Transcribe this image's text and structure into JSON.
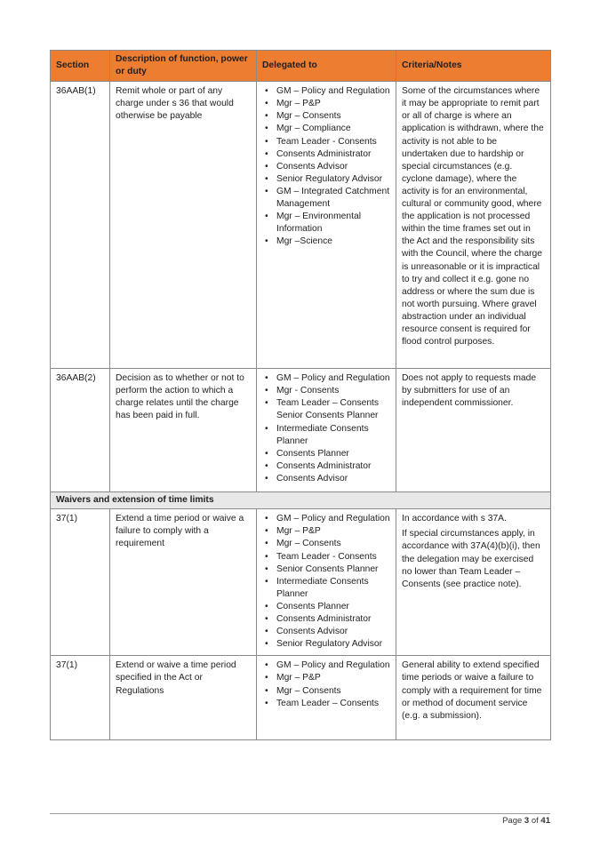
{
  "colors": {
    "header_bg": "#ed7d31",
    "section_row_bg": "#e8e8e8",
    "border": "#8a8a8a"
  },
  "table": {
    "headers": [
      "Section",
      "Description of function, power or duty",
      "Delegated to",
      "Criteria/Notes"
    ],
    "rows": [
      {
        "section": "36AAB(1)",
        "description": "Remit whole or part of any charge under s 36 that would otherwise be payable",
        "delegated": [
          "GM – Policy and Regulation",
          "Mgr – P&P",
          "Mgr – Consents",
          "Mgr – Compliance",
          "Team Leader - Consents",
          "Consents Administrator",
          "Consents Advisor",
          "Senior Regulatory Advisor",
          "GM – Integrated Catchment Management",
          "Mgr – Environmental Information",
          "Mgr –Science"
        ],
        "notes": [
          "Some of the circumstances where it may be appropriate to remit part or all of charge is where an application is withdrawn, where the activity is not able to be undertaken due to hardship or special circumstances (e.g. cyclone damage), where the activity is for an environmental, cultural or community good, where the application is not processed within the time frames set out in the Act and the responsibility sits with the Council, where the charge is unreasonable or it is impractical to try and collect it e.g. gone no address or where the sum due is not worth pursuing. Where gravel abstraction under an individual resource consent is required for flood control purposes."
        ]
      },
      {
        "section": "36AAB(2)",
        "description": "Decision as to whether or not to perform the action to which a charge relates until the charge has been paid in full.",
        "delegated": [
          "GM – Policy and Regulation",
          "Mgr - Consents",
          "Team Leader – Consents Senior Consents Planner",
          "Intermediate Consents Planner",
          "Consents Planner",
          "Consents Administrator",
          "Consents Advisor"
        ],
        "notes": [
          "Does not apply to requests made by submitters for use of an independent commissioner."
        ]
      }
    ],
    "section_heading": "Waivers and extension of time limits",
    "rows2": [
      {
        "section": "37(1)",
        "description": "Extend a time period or waive a failure to comply with a requirement",
        "delegated": [
          "GM – Policy and Regulation",
          "Mgr – P&P",
          "Mgr – Consents",
          "Team Leader - Consents",
          "Senior Consents Planner",
          "Intermediate Consents Planner",
          "Consents Planner",
          "Consents Administrator",
          "Consents Advisor",
          "Senior Regulatory Advisor"
        ],
        "notes": [
          "In accordance with s 37A.",
          "If special circumstances apply, in accordance with 37A(4)(b)(i), then the delegation may be exercised no lower than Team Leader – Consents (see practice note)."
        ]
      },
      {
        "section": "37(1)",
        "description": "Extend or waive a time period specified in the Act or Regulations",
        "delegated": [
          "GM – Policy and Regulation",
          "Mgr – P&P",
          "Mgr – Consents",
          "Team Leader – Consents"
        ],
        "notes": [
          "General ability to extend specified time periods or waive a failure to comply with a requirement for time or method of document service (e.g. a submission)."
        ]
      }
    ]
  },
  "footer": {
    "page_label": "Page",
    "page_current": "3",
    "of_label": "of",
    "page_total": "41"
  }
}
